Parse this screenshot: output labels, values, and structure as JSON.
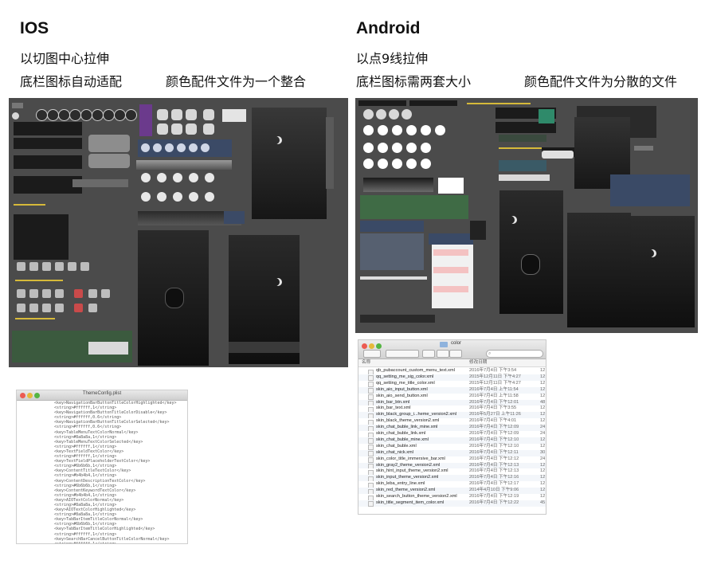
{
  "ios": {
    "title": "IOS",
    "line1": "以切图中心拉伸",
    "line2": "底栏图标自动适配",
    "line3": "颜色配件文件为一个整合"
  },
  "android": {
    "title": "Android",
    "line1": "以点9线拉伸",
    "line2": "底栏图标需两套大小",
    "line3": "颜色配件文件为分散的文件"
  },
  "plist_window": {
    "title": "ThemeConfig.plist",
    "lines": [
      "<key>NavigationBarButtonTitleColorHighlighted</key>",
      "<string>#ffffff,1</string>",
      "<key>NavigationBarButtonTitleColorDisable</key>",
      "<string>#ffffff,0.6</string>",
      "<key>NavigationBarButtonTitleColorSelected</key>",
      "<string>#ffffff,0.6</string>",
      "<key>TableMenuTextColorNormal</key>",
      "<string>#8a8a8a,1</string>",
      "<key>TableMenuTextColorSelected</key>",
      "<string>#ffffff,1</string>",
      "<key>TextFieldTextColor</key>",
      "<string>#ffffff,1</string>",
      "<key>TextFieldPlaceholderTextColor</key>",
      "<string>#6b6b6b,1</string>",
      "<key>ContentTitleTextColor</key>",
      "<string>#b4b4b4,1</string>",
      "<key>ContentDescriptionTextColor</key>",
      "<string>#6b6b6b,1</string>",
      "<key>ContentKeywordTextColor</key>",
      "<string>#b4b4b4,1</string>",
      "<key>AIOTextColorNormal</key>",
      "<string>#8a8a8a,1</string>",
      "<key>AIOTextColorHighlighted</key>",
      "<string>#8a8a8a,1</string>",
      "<key>TabBarItemTitleColorNormal</key>",
      "<string>#6b6b6b,1</string>",
      "<key>TabBarItemTitleColorHighlighted</key>",
      "<string>#ffffff,1</string>",
      "<key>SearchBarCancelButtonTitleColorNormal</key>",
      "<string>#ffffff,1</string>",
      "<key>SearchBarCancelButtonTitleColorHighlighted</key>",
      "<string>#ffffff,1</string>",
      "<key>SearchRecordLastKeywordNormal</key>",
      "<string>#6b6b6b,1</string>"
    ]
  },
  "finder_window": {
    "title": "color",
    "col_name": "名称",
    "col_date": "修改日期",
    "files": [
      {
        "name": "qb_pubaccount_custom_menu_text.xml",
        "date": "2016年7月4日 下午3:54",
        "size": "12"
      },
      {
        "name": "qq_setting_me_sig_color.xml",
        "date": "2015年12月11日 下午4:27",
        "size": "12"
      },
      {
        "name": "qq_setting_me_title_color.xml",
        "date": "2015年12月11日 下午4:27",
        "size": "12"
      },
      {
        "name": "skin_aio_input_button.xml",
        "date": "2016年7月4日 上午11:54",
        "size": "12"
      },
      {
        "name": "skin_aio_send_button.xml",
        "date": "2016年7月4日 上午11:58",
        "size": "12"
      },
      {
        "name": "skin_bar_btn.xml",
        "date": "2016年7月4日 下午12:01",
        "size": "48"
      },
      {
        "name": "skin_bar_text.xml",
        "date": "2016年7月4日 下午3:55",
        "size": "12"
      },
      {
        "name": "skin_black_group_i...heme_version2.xml",
        "date": "2016年5月27日 上午11:26",
        "size": "12"
      },
      {
        "name": "skin_black_theme_version2.xml",
        "date": "2016年7月4日 下午4:01",
        "size": "12"
      },
      {
        "name": "skin_chat_buble_link_mine.xml",
        "date": "2016年7月4日 下午12:09",
        "size": "24"
      },
      {
        "name": "skin_chat_buble_link.xml",
        "date": "2016年7月4日 下午12:09",
        "size": "24"
      },
      {
        "name": "skin_chat_buble_mine.xml",
        "date": "2016年7月4日 下午12:10",
        "size": "12"
      },
      {
        "name": "skin_chat_buble.xml",
        "date": "2016年7月4日 下午12:10",
        "size": "12"
      },
      {
        "name": "skin_chat_nick.xml",
        "date": "2016年7月4日 下午12:11",
        "size": "30"
      },
      {
        "name": "skin_color_title_immersive_bar.xml",
        "date": "2016年7月4日 下午12:12",
        "size": "24"
      },
      {
        "name": "skin_gray2_theme_version2.xml",
        "date": "2016年7月4日 下午12:13",
        "size": "12"
      },
      {
        "name": "skin_hint_input_theme_version2.xml",
        "date": "2016年7月4日 下午12:13",
        "size": "12"
      },
      {
        "name": "skin_input_theme_version2.xml",
        "date": "2016年7月4日 下午12:16",
        "size": "12"
      },
      {
        "name": "skin_leba_entry_line.xml",
        "date": "2016年7月4日 下午12:17",
        "size": "12"
      },
      {
        "name": "skin_red_theme_version2.xml",
        "date": "2014年4月10日 下午9:06",
        "size": "12"
      },
      {
        "name": "skin_search_button_theme_version2.xml",
        "date": "2016年7月4日 下午12:19",
        "size": "12"
      },
      {
        "name": "skin_title_segment_item_color.xml",
        "date": "2016年7月4日 下午12:22",
        "size": "45"
      }
    ]
  },
  "colors": {
    "board_bg": "#4b4b4b",
    "accent_yellow": "#d6b93a",
    "accent_purple": "#6b3a8c",
    "accent_green": "#3f6b45"
  }
}
